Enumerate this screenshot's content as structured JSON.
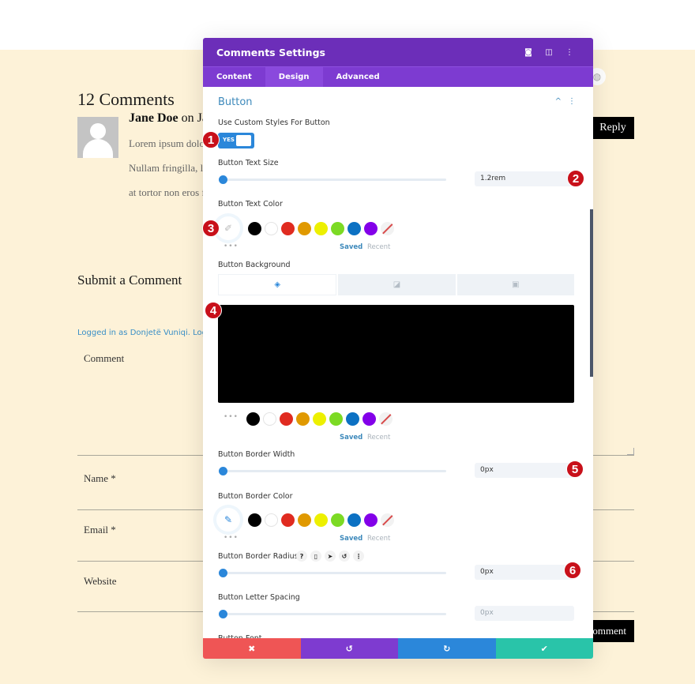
{
  "page": {
    "comments_title": "12 Comments",
    "comment": {
      "author": "Jane Doe",
      "meta": "on Ja",
      "lines": [
        "Lorem ipsum dolo",
        "Nullam fringilla, li",
        "at tortor non eros f"
      ],
      "reply_label": "Reply"
    },
    "submit_title": "Submit a Comment",
    "logged_in": "Logged in as Donjetë Vuniqi. Log out?",
    "form": {
      "comment_label": "Comment",
      "name_label": "Name *",
      "email_label": "Email *",
      "website_label": "Website",
      "submit_label": "omment"
    }
  },
  "modal": {
    "title": "Comments Settings",
    "header_icons": [
      "focus-icon",
      "split-view-icon",
      "more-vertical-icon"
    ],
    "tabs": [
      {
        "label": "Content",
        "active": false
      },
      {
        "label": "Design",
        "active": true
      },
      {
        "label": "Advanced",
        "active": false
      }
    ],
    "section_title": "Button",
    "fields": {
      "custom_styles": {
        "label": "Use Custom Styles For Button",
        "value": "YES"
      },
      "text_size": {
        "label": "Button Text Size",
        "value": "1.2rem",
        "slider_fraction": 0
      },
      "text_color": {
        "label": "Button Text Color"
      },
      "background": {
        "label": "Button Background",
        "color": "#000000"
      },
      "border_width": {
        "label": "Button Border Width",
        "value": "0px",
        "slider_fraction": 0
      },
      "border_color": {
        "label": "Button Border Color"
      },
      "border_radius": {
        "label": "Button Border Radius",
        "value": "0px",
        "slider_fraction": 0
      },
      "letter_spacing": {
        "label": "Button Letter Spacing",
        "value": "0px",
        "slider_fraction": 0
      },
      "font": {
        "label": "Button Font"
      }
    },
    "palette": [
      "#000000",
      "#ffffff",
      "#e02b20",
      "#e09900",
      "#edf000",
      "#7cda24",
      "#0c71c3",
      "#8300e9"
    ],
    "saved_label": "Saved",
    "recent_label": "Recent",
    "footer": {
      "cancel_color": "#ef5555",
      "undo_color": "#7e3bd0",
      "redo_color": "#2b87da",
      "save_color": "#29c4a9"
    }
  },
  "badges": [
    "1",
    "2",
    "3",
    "4",
    "5",
    "6"
  ]
}
